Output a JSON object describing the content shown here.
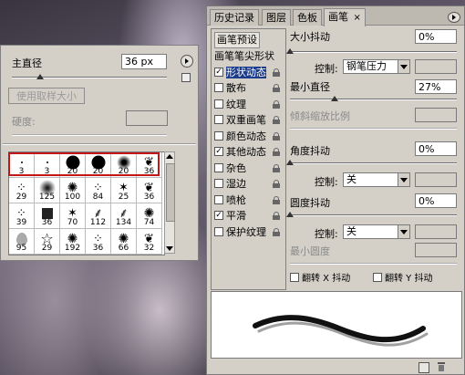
{
  "brush_picker": {
    "master_diameter_label": "主直径",
    "master_diameter_value": "36 px",
    "master_diameter_fraction": 0.18,
    "use_sample_size_label": "使用取样大小",
    "hardness_label": "硬度:",
    "hardness_value": "",
    "presets": [
      {
        "size": "3",
        "kind": "dot-small"
      },
      {
        "size": "3",
        "kind": "dot-small"
      },
      {
        "size": "20",
        "kind": "hard"
      },
      {
        "size": "20",
        "kind": "hard"
      },
      {
        "size": "20",
        "kind": "soft"
      },
      {
        "size": "36",
        "kind": "leaf"
      },
      {
        "size": "29",
        "kind": "scatter"
      },
      {
        "size": "125",
        "kind": "soft-big"
      },
      {
        "size": "100",
        "kind": "splat"
      },
      {
        "size": "84",
        "kind": "scatter"
      },
      {
        "size": "25",
        "kind": "star-s"
      },
      {
        "size": "36",
        "kind": "leaf"
      },
      {
        "size": "39",
        "kind": "scatter"
      },
      {
        "size": "36",
        "kind": "square"
      },
      {
        "size": "70",
        "kind": "star-s"
      },
      {
        "size": "112",
        "kind": "grass"
      },
      {
        "size": "134",
        "kind": "grass"
      },
      {
        "size": "74",
        "kind": "splat"
      },
      {
        "size": "95",
        "kind": "leaf2"
      },
      {
        "size": "29",
        "kind": "star"
      },
      {
        "size": "192",
        "kind": "splat"
      },
      {
        "size": "36",
        "kind": "scatter"
      },
      {
        "size": "66",
        "kind": "splat"
      },
      {
        "size": "32",
        "kind": "leaf"
      }
    ]
  },
  "brushes_panel": {
    "tabs": [
      {
        "label": "历史记录",
        "active": false
      },
      {
        "label": "图层",
        "active": false
      },
      {
        "label": "色板",
        "active": false
      },
      {
        "label": "画笔",
        "active": true
      }
    ],
    "close_glyph": "×",
    "presets_header": "画笔预设",
    "options": [
      {
        "label": "画笔笔尖形状",
        "checkbox": false,
        "checked": false,
        "lock": false
      },
      {
        "label": "形状动态",
        "checkbox": true,
        "checked": true,
        "lock": true,
        "selected": true
      },
      {
        "label": "散布",
        "checkbox": true,
        "checked": false,
        "lock": true
      },
      {
        "label": "纹理",
        "checkbox": true,
        "checked": false,
        "lock": true
      },
      {
        "label": "双重画笔",
        "checkbox": true,
        "checked": false,
        "lock": true
      },
      {
        "label": "颜色动态",
        "checkbox": true,
        "checked": false,
        "lock": true
      },
      {
        "label": "其他动态",
        "checkbox": true,
        "checked": true,
        "lock": true
      },
      {
        "label": "杂色",
        "checkbox": true,
        "checked": false,
        "lock": true
      },
      {
        "label": "湿边",
        "checkbox": true,
        "checked": false,
        "lock": true
      },
      {
        "label": "喷枪",
        "checkbox": true,
        "checked": false,
        "lock": true
      },
      {
        "label": "平滑",
        "checkbox": true,
        "checked": true,
        "lock": true
      },
      {
        "label": "保护纹理",
        "checkbox": true,
        "checked": false,
        "lock": true
      }
    ],
    "size_jitter_label": "大小抖动",
    "size_jitter_value": "0%",
    "size_jitter_fraction": 0.0,
    "control_label": "控制:",
    "size_control_value": "钢笔压力",
    "min_diameter_label": "最小直径",
    "min_diameter_value": "27%",
    "min_diameter_fraction": 0.27,
    "tilt_scale_label": "倾斜缩放比例",
    "angle_jitter_label": "角度抖动",
    "angle_jitter_value": "0%",
    "angle_jitter_fraction": 0.0,
    "angle_control_value": "关",
    "roundness_jitter_label": "圆度抖动",
    "roundness_jitter_value": "0%",
    "roundness_jitter_fraction": 0.0,
    "roundness_control_value": "关",
    "min_roundness_label": "最小圆度",
    "flip_x_label": "翻转 X 抖动",
    "flip_y_label": "翻转 Y 抖动"
  }
}
